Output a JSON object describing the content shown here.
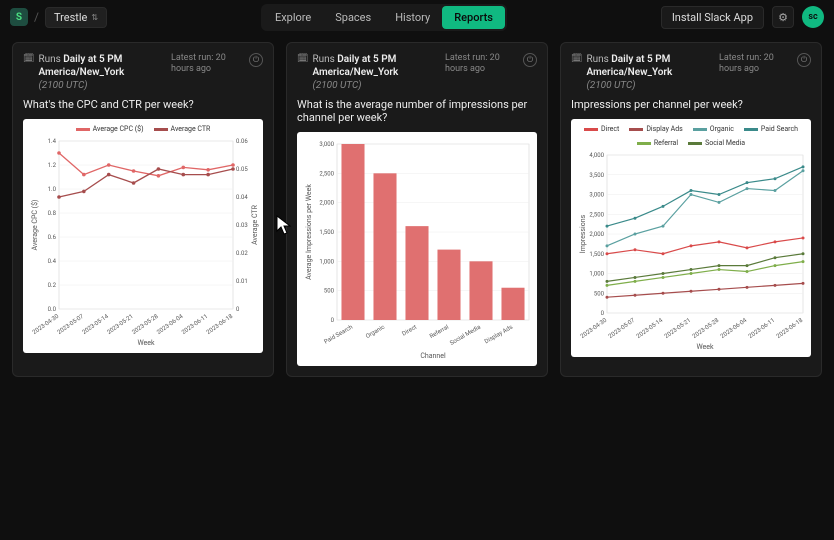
{
  "header": {
    "workspace": "Trestle",
    "nav": [
      "Explore",
      "Spaces",
      "History",
      "Reports"
    ],
    "active_nav": 3,
    "slack_label": "Install Slack App",
    "avatar_initials": "sc"
  },
  "cards": [
    {
      "schedule_prefix": "Runs",
      "schedule_bold": "Daily at 5 PM America/New_York",
      "schedule_sub": "(2100 UTC)",
      "lastrun": "Latest run: 20 hours ago",
      "title": "What's the CPC and CTR per week?"
    },
    {
      "schedule_prefix": "Runs",
      "schedule_bold": "Daily at 5 PM America/New_York",
      "schedule_sub": "(2100 UTC)",
      "lastrun": "Latest run: 20 hours ago",
      "title": "What is the average number of impressions per channel per week?"
    },
    {
      "schedule_prefix": "Runs",
      "schedule_bold": "Daily at 5 PM America/New_York",
      "schedule_sub": "(2100 UTC)",
      "lastrun": "Latest run: 20 hours ago",
      "title": "Impressions per channel per week?"
    }
  ],
  "chart_data": [
    {
      "type": "line",
      "title": "",
      "xlabel": "Week",
      "ylabel_left": "Average CPC ($)",
      "ylabel_right": "Average CTR",
      "x": [
        "2023-04-30",
        "2023-05-07",
        "2023-05-14",
        "2023-05-21",
        "2023-05-28",
        "2023-06-04",
        "2023-06-11",
        "2023-06-18"
      ],
      "ylim_left": [
        0,
        1.4
      ],
      "yticks_left": [
        0,
        0.2,
        0.4,
        0.6,
        0.8,
        1.0,
        1.2,
        1.4
      ],
      "ylim_right": [
        0,
        0.06
      ],
      "yticks_right": [
        0,
        0.01,
        0.02,
        0.03,
        0.04,
        0.05,
        0.06
      ],
      "series": [
        {
          "name": "Average CPC ($)",
          "color": "#e06666",
          "axis": "left",
          "values": [
            1.3,
            1.12,
            1.2,
            1.15,
            1.11,
            1.18,
            1.16,
            1.2
          ]
        },
        {
          "name": "Average CTR",
          "color": "#a64d4d",
          "axis": "right",
          "values": [
            0.04,
            0.042,
            0.048,
            0.045,
            0.05,
            0.048,
            0.048,
            0.05
          ]
        }
      ]
    },
    {
      "type": "bar",
      "title": "",
      "xlabel": "Channel",
      "ylabel": "Average Impressions per Week",
      "categories": [
        "Paid Search",
        "Organic",
        "Direct",
        "Referral",
        "Social Media",
        "Display Ads"
      ],
      "ylim": [
        0,
        3000
      ],
      "yticks": [
        0,
        500,
        1000,
        1500,
        2000,
        2500,
        3000
      ],
      "values": [
        3000,
        2500,
        1600,
        1200,
        1000,
        550
      ],
      "color": "#e07070"
    },
    {
      "type": "line",
      "title": "",
      "xlabel": "Week",
      "ylabel": "Impressions",
      "x": [
        "2023-04-30",
        "2023-05-07",
        "2023-05-14",
        "2023-05-21",
        "2023-05-28",
        "2023-06-04",
        "2023-06-11",
        "2023-06-18"
      ],
      "ylim": [
        0,
        4000
      ],
      "yticks": [
        0,
        500,
        1000,
        1500,
        2000,
        2500,
        3000,
        3500,
        4000
      ],
      "series": [
        {
          "name": "Direct",
          "color": "#d94a4a",
          "values": [
            1500,
            1600,
            1500,
            1700,
            1800,
            1650,
            1800,
            1900
          ]
        },
        {
          "name": "Display Ads",
          "color": "#a64d4d",
          "values": [
            400,
            450,
            500,
            550,
            600,
            650,
            700,
            750
          ]
        },
        {
          "name": "Organic",
          "color": "#5aa0a0",
          "values": [
            1700,
            2000,
            2200,
            3000,
            2800,
            3150,
            3100,
            3600
          ]
        },
        {
          "name": "Paid Search",
          "color": "#3a8a8a",
          "values": [
            2200,
            2400,
            2700,
            3100,
            3000,
            3300,
            3400,
            3700
          ]
        },
        {
          "name": "Referral",
          "color": "#7fae4a",
          "values": [
            700,
            800,
            900,
            1000,
            1100,
            1050,
            1200,
            1300
          ]
        },
        {
          "name": "Social Media",
          "color": "#5a7a3a",
          "values": [
            800,
            900,
            1000,
            1100,
            1200,
            1200,
            1400,
            1500
          ]
        }
      ]
    }
  ]
}
